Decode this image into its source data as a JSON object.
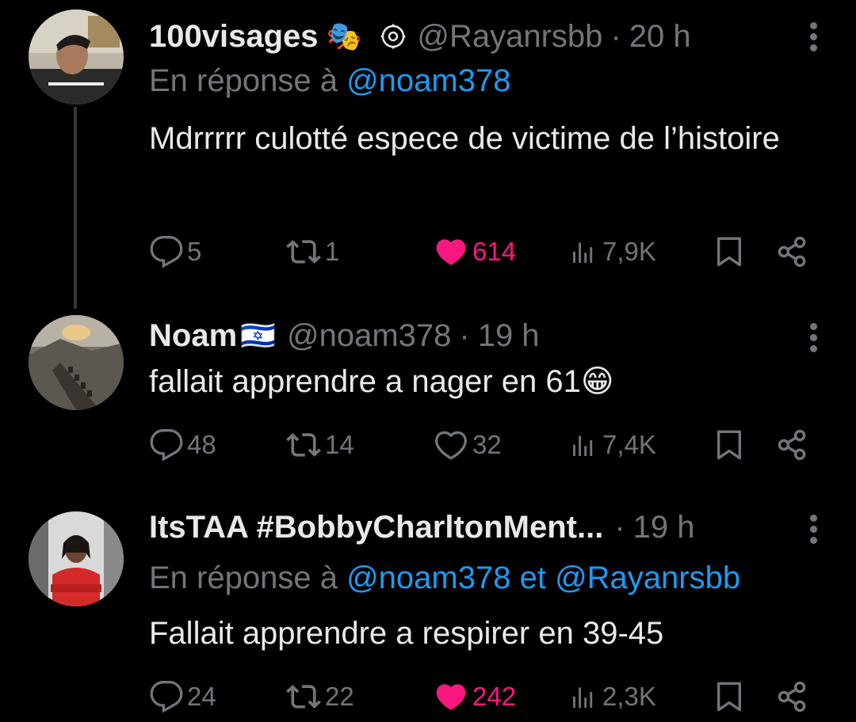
{
  "tweets": [
    {
      "name": "100visages",
      "name_emoji": "🎭",
      "badge": "⎈",
      "handle": "@Rayanrsbb",
      "dot": "·",
      "time": "20 h",
      "reply_prefix": "En réponse à",
      "reply_mentions": "@noam378",
      "text": "Mdrrrrr culotté espece de victime de l’histoire",
      "replies": "5",
      "reposts": "1",
      "likes": "614",
      "liked": true,
      "views": "7,9K"
    },
    {
      "name": "Noam",
      "name_emoji": "🇮🇱",
      "handle": "@noam378",
      "dot": "·",
      "time": "19 h",
      "text": "fallait apprendre a nager en 61😁",
      "replies": "48",
      "reposts": "14",
      "likes": "32",
      "liked": false,
      "views": "7,4K"
    },
    {
      "name": "ItsTAA #BobbyCharltonMent...",
      "handle": "",
      "dot": "·",
      "time": "19 h",
      "reply_prefix": "En réponse à",
      "reply_mentions": "@noam378 et @Rayanrsbb",
      "text": "Fallait apprendre a respirer en 39-45",
      "replies": "24",
      "reposts": "22",
      "likes": "242",
      "liked": true,
      "views": "2,3K"
    }
  ],
  "icons": {
    "reply": "reply-icon",
    "repost": "repost-icon",
    "like": "heart-icon",
    "views": "views-icon",
    "bookmark": "bookmark-icon",
    "share": "share-icon",
    "more": "more-icon"
  },
  "colors": {
    "background": "#000000",
    "text": "#e7e9ea",
    "muted": "#71767b",
    "link": "#1d9bf0",
    "like": "#f91880"
  }
}
